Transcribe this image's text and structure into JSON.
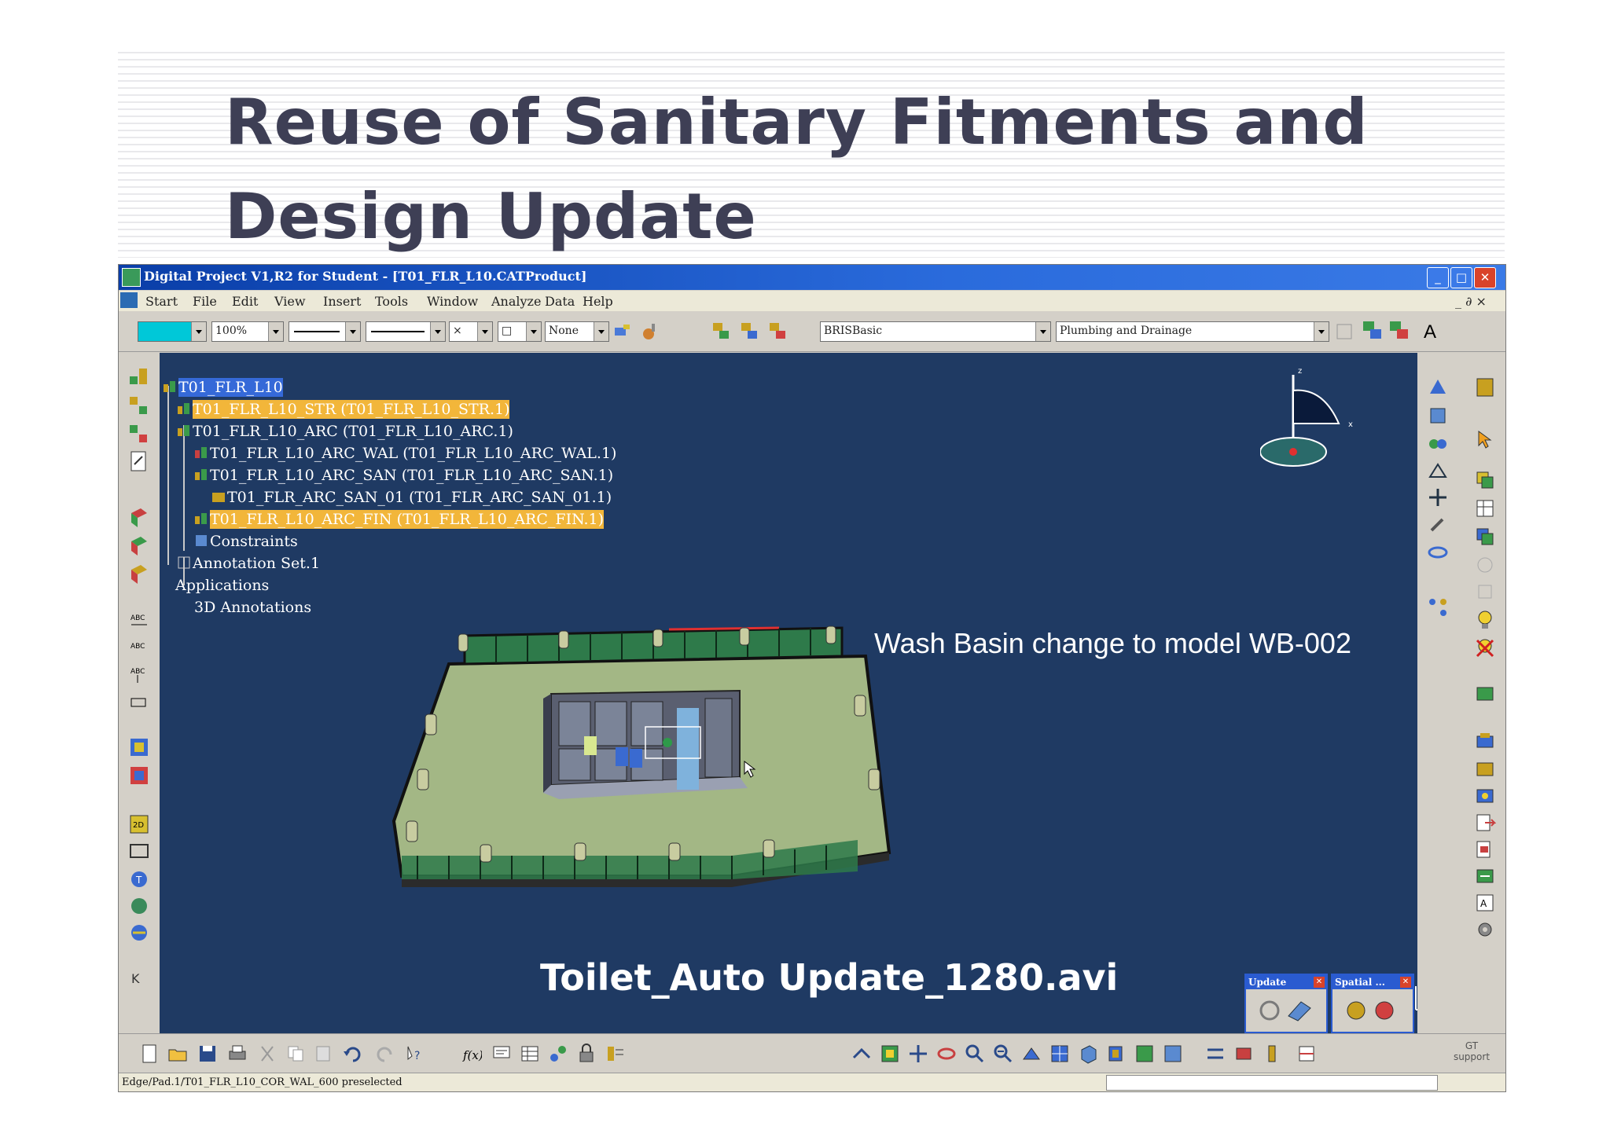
{
  "slide": {
    "title_line1": "Reuse of Sanitary Fitments and",
    "title_line2": "Design Update"
  },
  "window": {
    "title": "Digital Project V1,R2 for Student - [T01_FLR_L10.CATProduct]",
    "minimize": "_",
    "maximize": "□",
    "close": "✕"
  },
  "menu": {
    "items": [
      "Start",
      "File",
      "Edit",
      "View",
      "Insert",
      "Tools",
      "Window",
      "Analyze",
      "Data",
      "Help"
    ],
    "doc_controls": "_ ∂ ×"
  },
  "toolbar": {
    "zoom": "100%",
    "layer": "None",
    "standard": "BRISBasic",
    "discipline": "Plumbing and Drainage",
    "text_tool": "A"
  },
  "tree": {
    "root": "T01_FLR_L10",
    "items": [
      "T01_FLR_L10_STR (T01_FLR_L10_STR.1)",
      "T01_FLR_L10_ARC (T01_FLR_L10_ARC.1)",
      "T01_FLR_L10_ARC_WAL (T01_FLR_L10_ARC_WAL.1)",
      "T01_FLR_L10_ARC_SAN (T01_FLR_L10_ARC_SAN.1)",
      "T01_FLR_ARC_SAN_01 (T01_FLR_ARC_SAN_01.1)",
      "T01_FLR_L10_ARC_FIN (T01_FLR_L10_ARC_FIN.1)",
      "Constraints",
      "Annotation Set.1",
      "Applications",
      "3D Annotations"
    ]
  },
  "viewport": {
    "annotation": "Wash Basin change to model WB-002",
    "movie_file": "Toilet_Auto Update_1280.avi",
    "compass_x": "x",
    "compass_z": "z"
  },
  "panels": {
    "update": "Update",
    "spatial": "Spatial ..."
  },
  "bottom": {
    "gt_label": "GT",
    "support_label": "support"
  },
  "status": {
    "text": "Edge/Pad.1/T01_FLR_L10_COR_WAL_600 preselected"
  },
  "colors": {
    "viewport_bg": "#1f3a63",
    "selection": "#3569d8",
    "highlight": "#f2b63a",
    "floor": "#a3b785",
    "fence": "#2e7a4a"
  }
}
